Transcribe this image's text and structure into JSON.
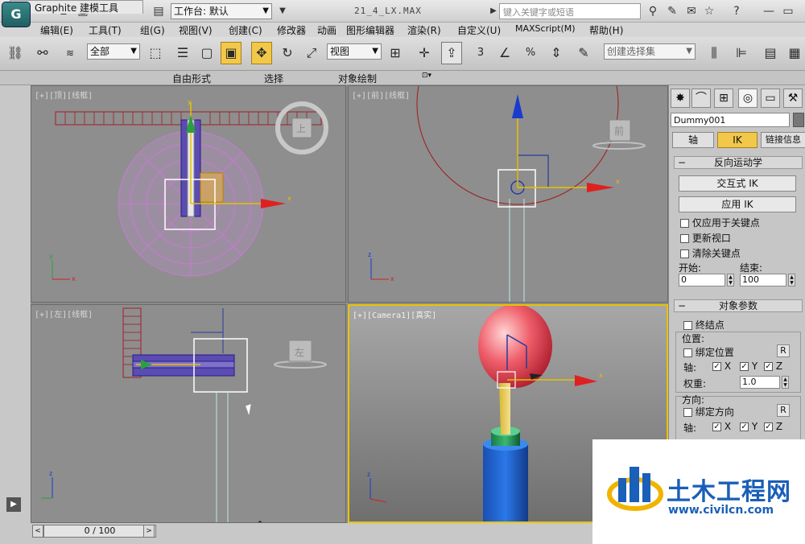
{
  "titlebar": {
    "app_logo": "G",
    "workspace_label": "工作台: 默认",
    "filename": "21_4_LX.MAX",
    "search_placeholder": "键入关键字或短语"
  },
  "menubar": {
    "items": [
      "编辑(E)",
      "工具(T)",
      "组(G)",
      "视图(V)",
      "创建(C)",
      "修改器",
      "动画",
      "图形编辑器",
      "渲染(R)",
      "自定义(U)",
      "MAXScript(M)",
      "帮助(H)"
    ]
  },
  "toolbar": {
    "filter_value": "全部",
    "refcoord_value": "视图",
    "selset_placeholder": "创建选择集",
    "snap_label": "3",
    "angle_label": "∠",
    "percent_label": "%"
  },
  "ribbon": {
    "tabs": [
      "Graphite 建模工具",
      "自由形式",
      "选择",
      "对象绘制"
    ]
  },
  "viewports": {
    "top_label": "[+][顶][线框]",
    "front_label": "[+][前][线框]",
    "left_label": "[+][左][线框]",
    "camera_label": "[+][Camera1][真实]",
    "front_cube": "前",
    "left_cube": "左",
    "top_cube": "上"
  },
  "timeline": {
    "slider_label": "0 / 100"
  },
  "panel": {
    "object_name": "Dummy001",
    "tabs": [
      "轴",
      "IK",
      "链接信息"
    ],
    "ik_rollout_title": "反向运动学",
    "interactive_ik": "交互式 IK",
    "apply_ik": "应用 IK",
    "only_keys": "仅应用于关键点",
    "update_viewports": "更新视口",
    "clear_keys": "清除关键点",
    "start_label": "开始:",
    "end_label": "结束:",
    "start_value": "0",
    "end_value": "100",
    "object_params_title": "对象参数",
    "terminator": "终结点",
    "position_group": "位置:",
    "bind_position": "绑定位置",
    "axis_label": "轴:",
    "axis_x": "X",
    "axis_y": "Y",
    "axis_z": "Z",
    "weight_label": "权重:",
    "weight_value": "1.0",
    "orientation_group": "方向:",
    "bind_orientation": "绑定方向",
    "r_button": "R"
  },
  "watermark": {
    "title": "土木工程网",
    "url": "www.civilcn.com"
  }
}
